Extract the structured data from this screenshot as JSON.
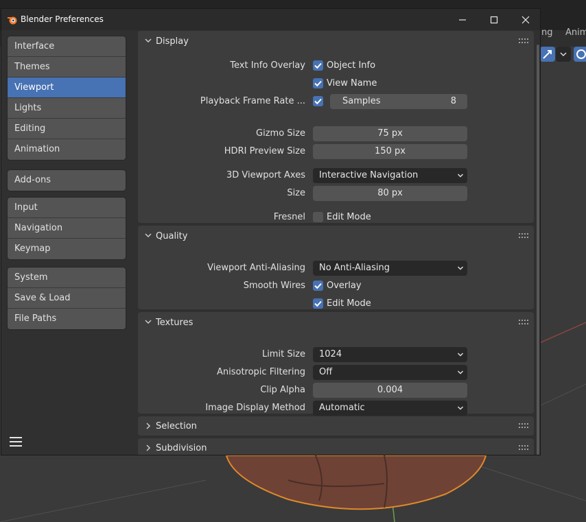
{
  "background": {
    "tabs": [
      "ng",
      "Anim"
    ]
  },
  "window": {
    "title": "Blender Preferences"
  },
  "sidebar": {
    "groups": [
      [
        "Interface",
        "Themes",
        "Viewport",
        "Lights",
        "Editing",
        "Animation"
      ],
      [
        "Add-ons"
      ],
      [
        "Input",
        "Navigation",
        "Keymap"
      ],
      [
        "System",
        "Save & Load",
        "File Paths"
      ]
    ],
    "active": "Viewport"
  },
  "display": {
    "title": "Display",
    "text_info_overlay_label": "Text Info Overlay",
    "object_info_label": "Object Info",
    "object_info_checked": true,
    "view_name_label": "View Name",
    "view_name_checked": true,
    "playback_label": "Playback Frame Rate ...",
    "playback_checked": true,
    "samples_label": "Samples",
    "samples_value": "8",
    "gizmo_size_label": "Gizmo Size",
    "gizmo_size_value": "75 px",
    "hdri_label": "HDRI Preview Size",
    "hdri_value": "150 px",
    "axes_label": "3D Viewport Axes",
    "axes_value": "Interactive Navigation",
    "size_label": "Size",
    "size_value": "80 px",
    "fresnel_label": "Fresnel",
    "fresnel_edit_label": "Edit Mode",
    "fresnel_edit_checked": false
  },
  "quality": {
    "title": "Quality",
    "aa_label": "Viewport Anti-Aliasing",
    "aa_value": "No Anti-Aliasing",
    "smooth_label": "Smooth Wires",
    "overlay_label": "Overlay",
    "overlay_checked": true,
    "edit_label": "Edit Mode",
    "edit_checked": true
  },
  "textures": {
    "title": "Textures",
    "limit_label": "Limit Size",
    "limit_value": "1024",
    "aniso_label": "Anisotropic Filtering",
    "aniso_value": "Off",
    "clip_label": "Clip Alpha",
    "clip_value": "0.004",
    "image_label": "Image Display Method",
    "image_value": "Automatic"
  },
  "selection": {
    "title": "Selection"
  },
  "subdivision": {
    "title": "Subdivision"
  },
  "colors": {
    "accent": "#4772b3",
    "panel": "#3d3d3d",
    "window": "#303030",
    "field": "#545454",
    "dropdown": "#282828"
  }
}
